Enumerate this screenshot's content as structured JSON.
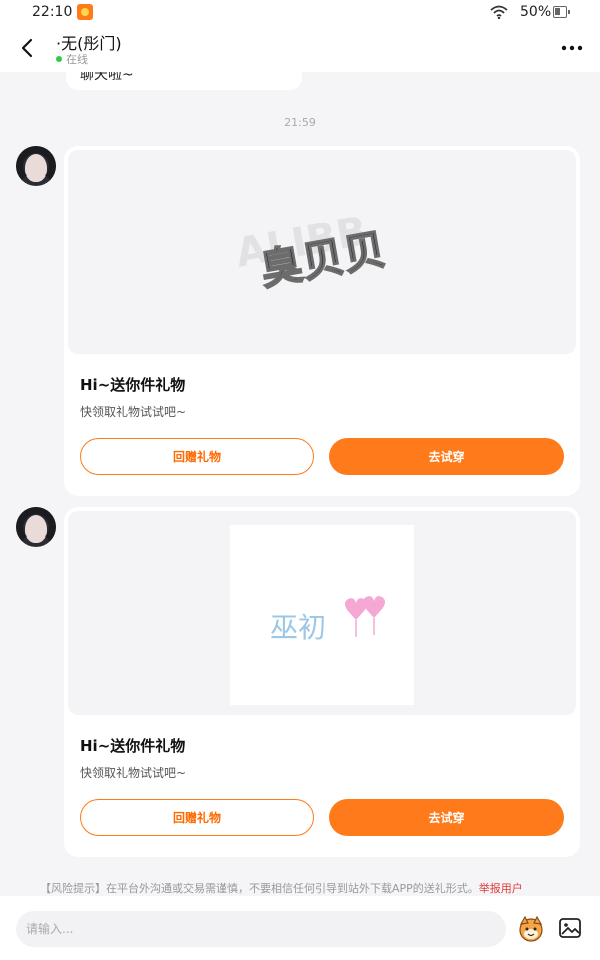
{
  "status_bar": {
    "time": "22:10",
    "battery": "50%"
  },
  "header": {
    "title": "·无(彤门)",
    "status": "在线"
  },
  "previous_message": {
    "text": "聊天啦~"
  },
  "timestamp": "21:59",
  "gift_cards": [
    {
      "image_text": "臭贝贝",
      "title": "Hi~送你件礼物",
      "subtitle": "快领取礼物试试吧~",
      "return_gift_label": "回赠礼物",
      "try_on_label": "去试穿"
    },
    {
      "image_text": "巫初",
      "title": "Hi~送你件礼物",
      "subtitle": "快领取礼物试试吧~",
      "return_gift_label": "回赠礼物",
      "try_on_label": "去试穿"
    }
  ],
  "risk_notice": {
    "text": "【风险提示】在平台外沟通或交易需谨慎，不要相信任何引导到站外下载APP的送礼形式。",
    "link_label": "举报用户"
  },
  "input_bar": {
    "placeholder": "请输入..."
  },
  "colors": {
    "accent": "#ff7a1a",
    "online": "#2ecc40",
    "warning": "#e03a3a"
  }
}
